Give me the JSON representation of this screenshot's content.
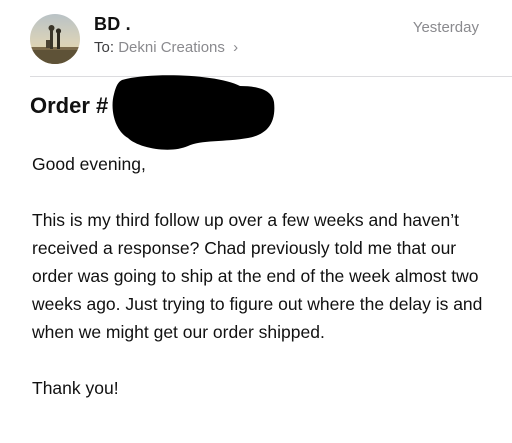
{
  "email": {
    "sender": {
      "name": "BD ."
    },
    "recipient": {
      "label": "To:",
      "name": "Dekni Creations",
      "chevron": "›"
    },
    "date": "Yesterday",
    "subject": "Order #",
    "body": {
      "greeting": "Good evening,",
      "paragraph": "This is my third follow up over a few weeks and haven’t received a response? Chad previously told me that our order was going to ship at the end of the week almost two weeks ago. Just trying to figure out where the delay is and when we might get our order shipped.",
      "closing": "Thank you!"
    }
  },
  "icons": {
    "avatar": "sender-avatar-photo",
    "recipient_chevron": "chevron-right-icon"
  },
  "colors": {
    "text_primary": "#111111",
    "text_secondary": "#8a8a8e",
    "divider": "#dcdcdf",
    "redaction": "#000000"
  }
}
